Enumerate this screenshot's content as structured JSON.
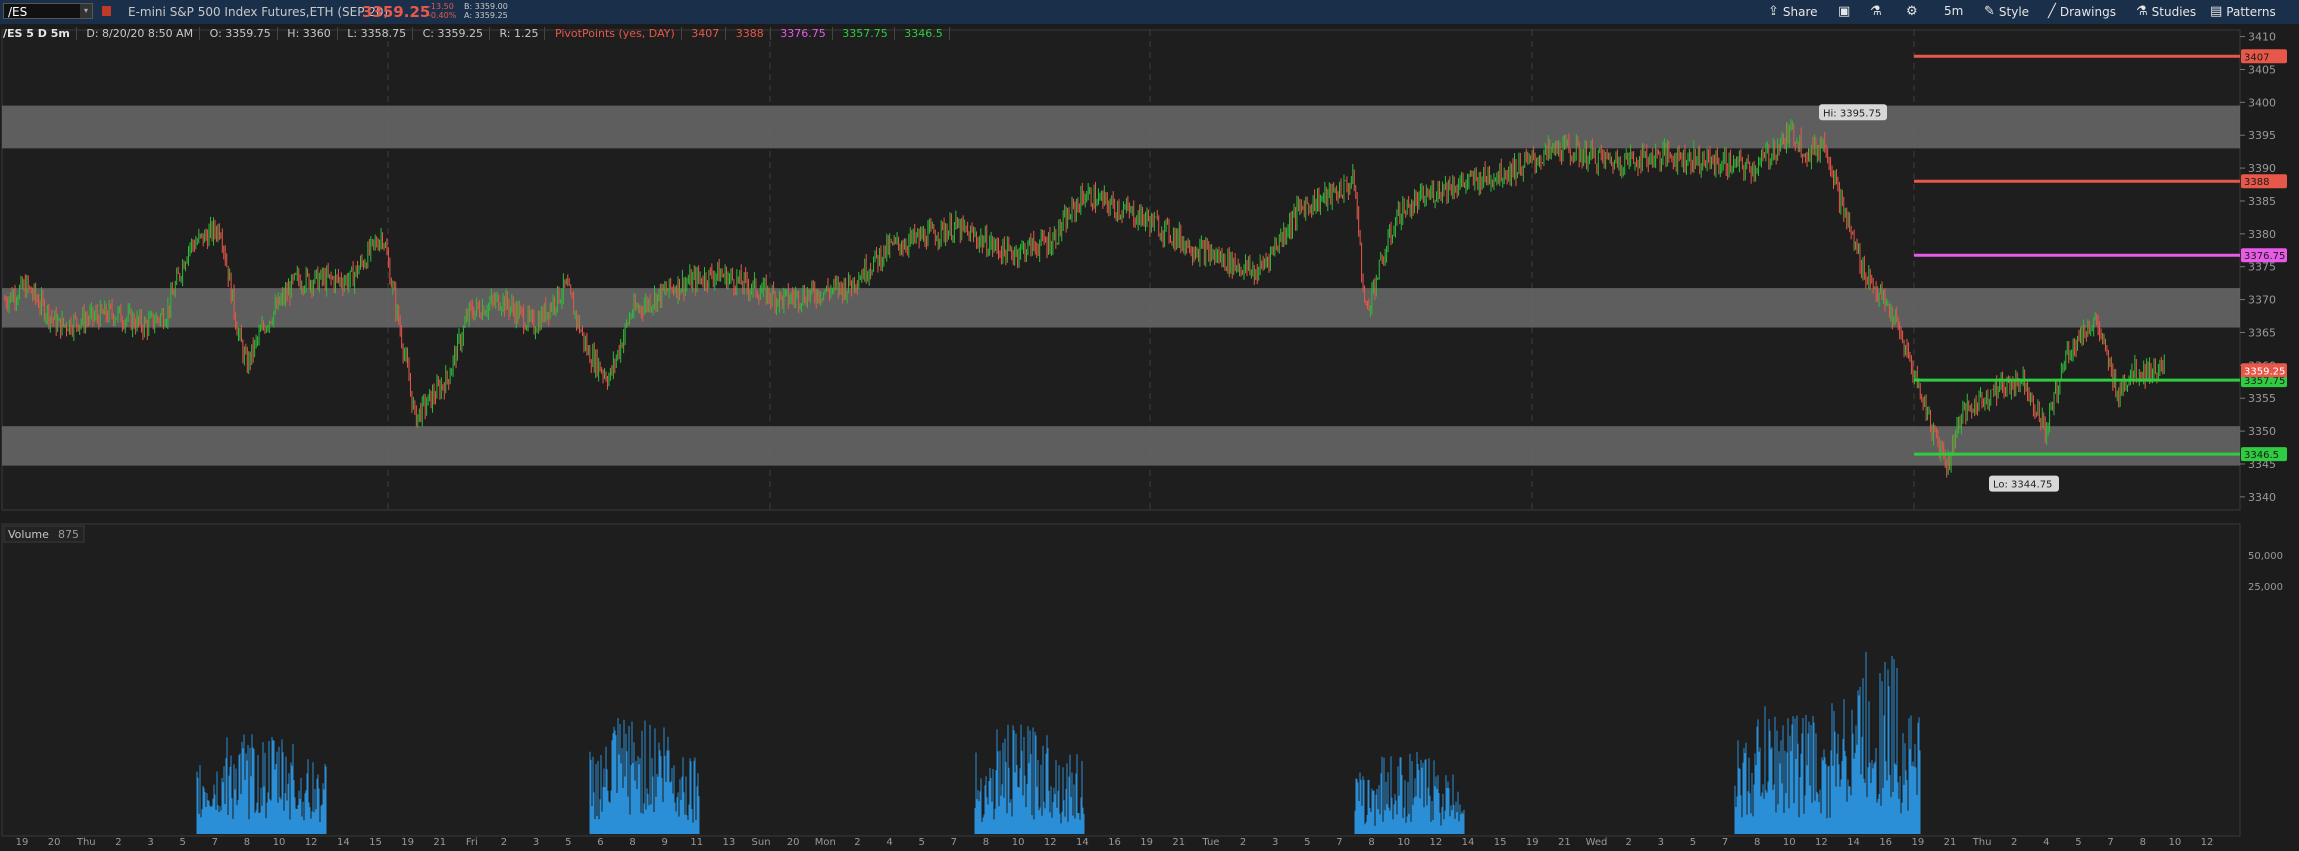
{
  "toolbar": {
    "symbol": "/ES",
    "description": "E-mini S&P 500 Index Futures,ETH (SEP 20)",
    "last_price": "3359.25",
    "net_change": "-13.50",
    "pct_change": "-0.40%",
    "bid": "B: 3359.00",
    "ask": "A: 3359.25",
    "buttons": {
      "share": "Share",
      "timeframe": "5m",
      "style": "Style",
      "drawings": "Drawings",
      "studies": "Studies",
      "patterns": "Patterns"
    }
  },
  "header": {
    "chart_label": "/ES 5 D 5m",
    "datetime": "D: 8/20/20 8:50 AM",
    "open": "O: 3359.75",
    "high": "H: 3360",
    "low": "L: 3358.75",
    "close": "C: 3359.25",
    "range": "R: 1.25",
    "study_name": "PivotPoints (yes, DAY)",
    "pivot_values": [
      "3407",
      "3388",
      "3376.75",
      "3357.75",
      "3346.5"
    ]
  },
  "volume": {
    "label": "Volume",
    "value": "875"
  },
  "colors": {
    "background": "#1c1c1c",
    "up": "#2ebd3a",
    "down": "#e8584a",
    "zone": "#6a6a6a",
    "r2": "#e8584a",
    "pivot": "#e85ae8",
    "s1": "#2ecc40",
    "volume": "#2a8fd6"
  },
  "chart_data": {
    "type": "line",
    "title": "/ES 5 D 5m",
    "ylabel": "",
    "xlabel": "",
    "ylim": [
      3338,
      3411
    ],
    "grid": true,
    "series": [
      {
        "name": "/ES",
        "x": [
          "Aug 14 18:00",
          "Aug 14 21:00",
          "Aug 16 21:00",
          "Aug 17 09:00",
          "Aug 17 12:00",
          "Aug 17 14:00",
          "Aug 17 16:00",
          "Aug 18 00:00",
          "Aug 18 03:00",
          "Aug 18 09:00",
          "Aug 18 12:00",
          "Aug 18 16:00",
          "Aug 18 20:00",
          "Aug 19 03:00",
          "Aug 19 09:00",
          "Aug 19 12:00",
          "Aug 19 14:00",
          "Aug 19 16:00",
          "Aug 19 20:00",
          "Aug 20 00:00",
          "Aug 20 05:00",
          "Aug 20 08:50"
        ],
        "values": [
          3370,
          3368,
          3366,
          3379,
          3380,
          3358,
          3372,
          3375,
          3352,
          3371,
          3362,
          3374,
          3369,
          3350,
          3370,
          3372,
          3356,
          3372,
          3371,
          3375,
          3369,
          3383
        ]
      }
    ],
    "price_ticks": [
      "3410",
      "3405",
      "3400",
      "3395",
      "3390",
      "3385",
      "3380",
      "3375",
      "3370",
      "3365",
      "3360",
      "3355",
      "3350",
      "3345",
      "3340"
    ],
    "time_ticks": [
      "19",
      "20",
      "Thu",
      "2",
      "3",
      "5",
      "7",
      "8",
      "10",
      "12",
      "14",
      "15",
      "19",
      "21",
      "Fri",
      "2",
      "3",
      "5",
      "6",
      "8",
      "9",
      "11",
      "13",
      "Sun",
      "20",
      "Mon",
      "2",
      "4",
      "5",
      "7",
      "8",
      "10",
      "12",
      "14",
      "16",
      "19",
      "21",
      "Tue",
      "2",
      "3",
      "5",
      "7",
      "8",
      "10",
      "12",
      "14",
      "15",
      "19",
      "21",
      "Wed",
      "2",
      "3",
      "5",
      "7",
      "8",
      "10",
      "12",
      "14",
      "16",
      "19",
      "21",
      "Thu",
      "2",
      "4",
      "5",
      "7",
      "8",
      "10",
      "12"
    ],
    "zones": [
      {
        "low": 3393,
        "high": 3399.5
      },
      {
        "low": 3365.75,
        "high": 3371.75
      },
      {
        "low": 3344.75,
        "high": 3350.75
      }
    ],
    "pivot_levels": [
      {
        "value": 3407,
        "label": "3407",
        "role": "r2"
      },
      {
        "value": 3388,
        "label": "3388",
        "role": "r2"
      },
      {
        "value": 3376.75,
        "label": "3376.75",
        "role": "pivot"
      },
      {
        "value": 3357.75,
        "label": "3357.75",
        "role": "s1"
      },
      {
        "value": 3346.5,
        "label": "3346.5",
        "role": "s1"
      }
    ],
    "current_price": "3359.25",
    "high_label": "Hi: 3395.75",
    "low_label": "Lo: 3344.75",
    "volume_ticks": [
      "50,000",
      "25,000"
    ]
  }
}
